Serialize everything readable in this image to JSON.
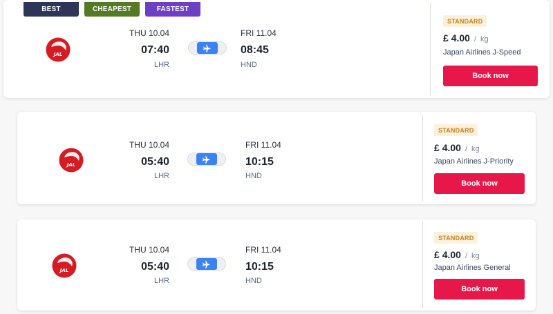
{
  "tags": {
    "best": "BEST",
    "cheapest": "CHEAPEST",
    "fastest": "FASTEST"
  },
  "colors": {
    "best": "#2d3558",
    "cheapest": "#547a25",
    "fastest": "#6d3fc7",
    "book": "#e8174a",
    "badge_text": "#c9831a",
    "badge_bg": "#fdf1dc",
    "plane": "#3b82f6",
    "jal_red": "#d61b23"
  },
  "icons": {
    "airline_logo": "jal-crane-logo",
    "flight": "plane-icon"
  },
  "flights": [
    {
      "dep_day": "THU 10.04",
      "dep_time": "07:40",
      "dep_code": "LHR",
      "arr_day": "FRI 11.04",
      "arr_time": "08:45",
      "arr_code": "HND",
      "class": "STANDARD",
      "currency": "£",
      "price": "4.00",
      "price_sep": "/",
      "unit": "kg",
      "service": "Japan Airlines J-Speed",
      "book_label": "Book now"
    },
    {
      "dep_day": "THU 10.04",
      "dep_time": "05:40",
      "dep_code": "LHR",
      "arr_day": "FRI 11.04",
      "arr_time": "10:15",
      "arr_code": "HND",
      "class": "STANDARD",
      "currency": "£",
      "price": "4.00",
      "price_sep": "/",
      "unit": "kg",
      "service": "Japan Airlines J-Priority",
      "book_label": "Book now"
    },
    {
      "dep_day": "THU 10.04",
      "dep_time": "05:40",
      "dep_code": "LHR",
      "arr_day": "FRI 11.04",
      "arr_time": "10:15",
      "arr_code": "HND",
      "class": "STANDARD",
      "currency": "£",
      "price": "4.00",
      "price_sep": "/",
      "unit": "kg",
      "service": "Japan Airlines General",
      "book_label": "Book now"
    }
  ]
}
